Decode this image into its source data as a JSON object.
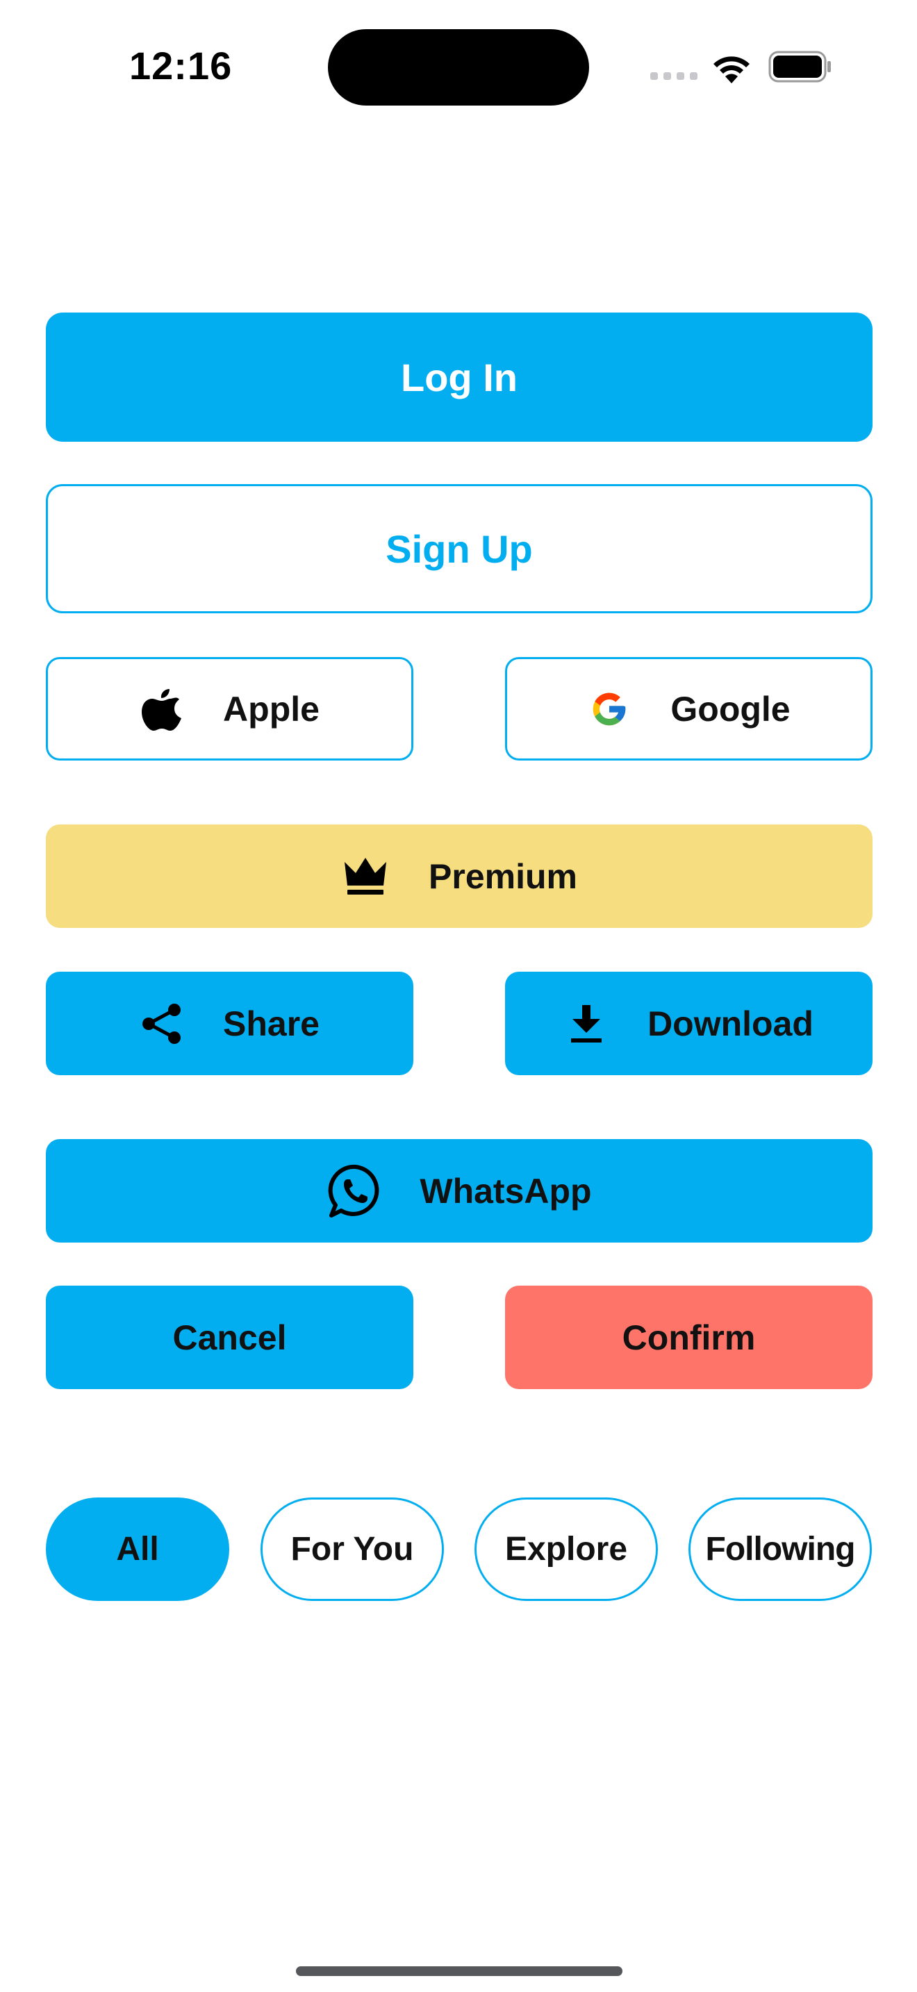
{
  "status_bar": {
    "time": "12:16"
  },
  "colors": {
    "primary": "#02aef0",
    "premium": "#f6dd80",
    "danger": "#ff7468",
    "text_dark": "#111111"
  },
  "buttons": {
    "login": "Log In",
    "signup": "Sign Up",
    "apple": {
      "label": "Apple",
      "icon": "apple-logo-icon"
    },
    "google": {
      "label": "Google",
      "icon": "google-logo-icon"
    },
    "premium": {
      "label": "Premium",
      "icon": "crown-icon"
    },
    "share": {
      "label": "Share",
      "icon": "share-icon"
    },
    "download": {
      "label": "Download",
      "icon": "download-icon"
    },
    "whatsapp": {
      "label": "WhatsApp",
      "icon": "whatsapp-icon"
    },
    "cancel": "Cancel",
    "confirm": "Confirm"
  },
  "filter_tabs": [
    {
      "label": "All",
      "selected": true
    },
    {
      "label": "For You",
      "selected": false
    },
    {
      "label": "Explore",
      "selected": false
    },
    {
      "label": "Following",
      "selected": false
    }
  ]
}
